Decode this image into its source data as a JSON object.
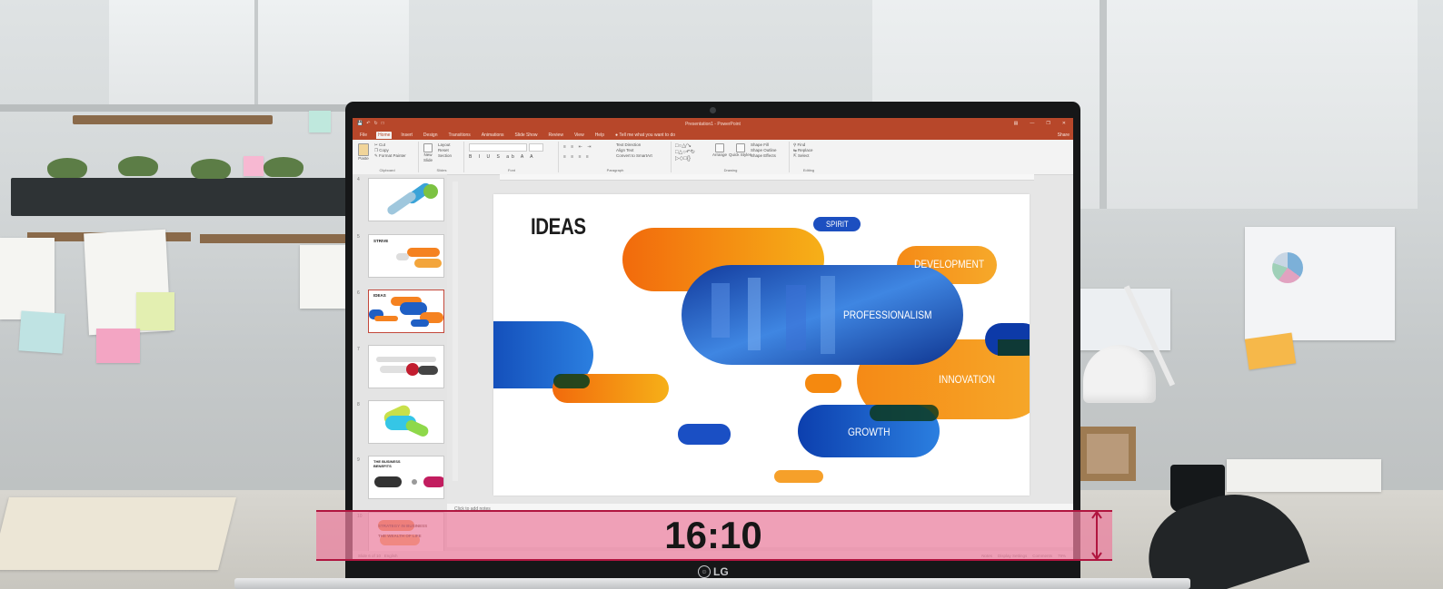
{
  "app": {
    "window_title": "Presentation1 - PowerPoint",
    "quick_access": [
      "save-icon",
      "undo-icon",
      "redo-icon",
      "present-icon"
    ],
    "share_label": "Share",
    "tell_me": "Tell me what you want to do"
  },
  "tabs": [
    "File",
    "Home",
    "Insert",
    "Design",
    "Transitions",
    "Animations",
    "Slide Show",
    "Review",
    "View",
    "Help"
  ],
  "active_tab": "Home",
  "ribbon": {
    "clipboard": {
      "label": "Clipboard",
      "paste": "Paste",
      "cut": "Cut",
      "copy": "Copy",
      "format_painter": "Format Painter"
    },
    "slides": {
      "label": "Slides",
      "new_slide": "New Slide",
      "layout": "Layout",
      "reset": "Reset",
      "section": "Section"
    },
    "font": {
      "label": "Font"
    },
    "paragraph": {
      "label": "Paragraph",
      "text_direction": "Text Direction",
      "align_text": "Align Text",
      "convert_smartart": "Convert to SmartArt"
    },
    "drawing": {
      "label": "Drawing",
      "arrange": "Arrange",
      "quick_styles": "Quick Styles",
      "shape_fill": "Shape Fill",
      "shape_outline": "Shape Outline",
      "shape_effects": "Shape Effects"
    },
    "editing": {
      "label": "Editing",
      "find": "Find",
      "replace": "Replace",
      "select": "Select"
    }
  },
  "slides_panel": {
    "thumbnails": [
      {
        "num": "4",
        "caption": ""
      },
      {
        "num": "5",
        "caption": "STRIVE"
      },
      {
        "num": "6",
        "caption": "IDEAS"
      },
      {
        "num": "7",
        "caption": ""
      },
      {
        "num": "8",
        "caption": ""
      },
      {
        "num": "9",
        "caption": "THE BUSINESS BENEFITS"
      },
      {
        "num": "10",
        "caption": "STRATEGY IN BUSINESS THE WEALTH OF LIFE"
      }
    ],
    "selected_index": 2
  },
  "slide": {
    "title": "IDEAS",
    "labels": {
      "spirit": "SPIRIT",
      "development": "DEVELOPMENT",
      "professionalism": "PROFESSIONALISM",
      "innovation": "INNOVATION",
      "growth": "GROWTH"
    }
  },
  "notes": {
    "placeholder": "Click to add notes"
  },
  "statusbar": {
    "slide_info": "Slide 6 of 10",
    "language": "English",
    "notes": "Notes",
    "display_settings": "Display Settings",
    "comments": "Comments",
    "zoom": "79%"
  },
  "overlay": {
    "ratio_text": "16:10",
    "band_color": "#ec7e9e",
    "line_color": "#b0153f"
  },
  "monitor": {
    "brand": "LG"
  },
  "colors": {
    "ppt_accent": "#b7472a",
    "orange": "#f58220",
    "blue": "#1f5fc4"
  }
}
